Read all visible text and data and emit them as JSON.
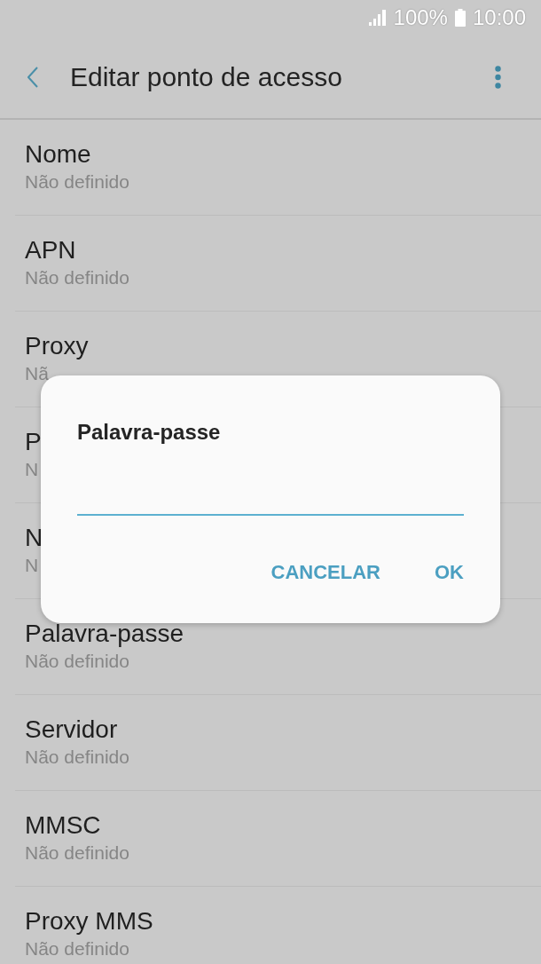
{
  "status_bar": {
    "battery": "100%",
    "time": "10:00"
  },
  "header": {
    "title": "Editar ponto de acesso"
  },
  "settings": [
    {
      "title": "Nome",
      "value": "Não definido"
    },
    {
      "title": "APN",
      "value": "Não definido"
    },
    {
      "title": "Proxy",
      "value": "Nã"
    },
    {
      "title": "P",
      "value": "N"
    },
    {
      "title": "N",
      "value": "N"
    },
    {
      "title": "Palavra-passe",
      "value": "Não definido"
    },
    {
      "title": "Servidor",
      "value": "Não definido"
    },
    {
      "title": "MMSC",
      "value": "Não definido"
    },
    {
      "title": "Proxy MMS",
      "value": "Não definido"
    }
  ],
  "dialog": {
    "title": "Palavra-passe",
    "field": {
      "focused": true
    },
    "buttons": [
      "CANCELAR",
      "OK"
    ]
  }
}
